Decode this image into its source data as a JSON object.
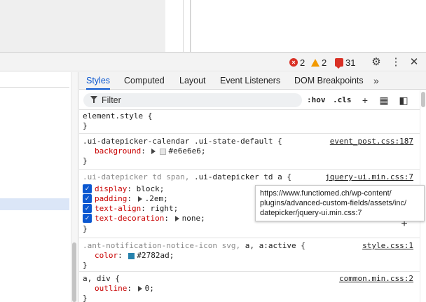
{
  "toolbar": {
    "errors": "2",
    "warnings": "2",
    "issues": "31"
  },
  "tabs": [
    {
      "label": "Styles",
      "active": true
    },
    {
      "label": "Computed",
      "active": false
    },
    {
      "label": "Layout",
      "active": false
    },
    {
      "label": "Event Listeners",
      "active": false
    },
    {
      "label": "DOM Breakpoints",
      "active": false
    }
  ],
  "filter": {
    "placeholder": "Filter",
    "hov": ":hov",
    "cls": ".cls"
  },
  "rules": [
    {
      "selector": "element.style {",
      "close": "}"
    },
    {
      "selector": ".ui-datepicker-calendar .ui-state-default {",
      "source": "event_post.css:187",
      "props": [
        {
          "name": "background",
          "value": "#e6e6e6",
          "swatch": "#e6e6e6"
        }
      ],
      "close": "}"
    },
    {
      "selector_dim": ".ui-datepicker td span,",
      "selector_main": ".ui-datepicker td a {",
      "source": "jquery-ui.min.css:7",
      "props": [
        {
          "name": "display",
          "value": "block;"
        },
        {
          "name": "padding",
          "value": ".2em;"
        },
        {
          "name": "text-align",
          "value": "right;"
        },
        {
          "name": "text-decoration",
          "value": "none;"
        }
      ],
      "close": "}"
    },
    {
      "selector_dim": ".ant-notification-notice-icon svg,",
      "selector_main": "a, a:active {",
      "source": "style.css:1",
      "props": [
        {
          "name": "color",
          "value": "#2782ad;",
          "swatch": "#2782ad"
        }
      ],
      "close": "}"
    },
    {
      "selector_main": "a, div {",
      "source": "common.min.css:2",
      "props": [
        {
          "name": "outline",
          "value": "0;"
        }
      ],
      "close": "}"
    }
  ],
  "tooltip": {
    "lines": [
      "https://www.functiomed.ch/wp-content/",
      "plugins/advanced-custom-fields/assets/inc/",
      "datepicker/jquery-ui.min.css:7"
    ]
  },
  "colors": {
    "accent": "#0b57d0",
    "property": "#c80000",
    "error": "#d93025",
    "warning": "#f29900"
  }
}
